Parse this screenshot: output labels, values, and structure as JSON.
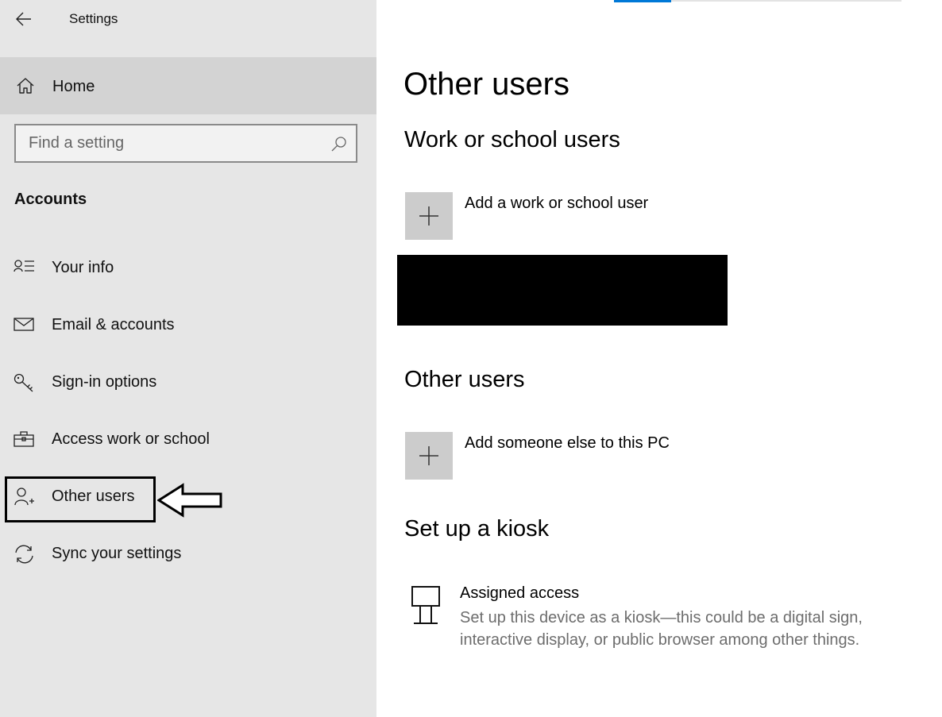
{
  "window": {
    "title": "Settings"
  },
  "sidebar": {
    "home_label": "Home",
    "search": {
      "placeholder": "Find a setting"
    },
    "section_label": "Accounts",
    "items": [
      {
        "label": "Your info",
        "icon": "person-info-icon"
      },
      {
        "label": "Email & accounts",
        "icon": "mail-icon"
      },
      {
        "label": "Sign-in options",
        "icon": "key-icon"
      },
      {
        "label": "Access work or school",
        "icon": "briefcase-icon"
      },
      {
        "label": "Other users",
        "icon": "add-person-icon",
        "selected": true
      },
      {
        "label": "Sync your settings",
        "icon": "sync-icon"
      }
    ]
  },
  "main": {
    "title": "Other users",
    "work_school": {
      "heading": "Work or school users",
      "add_label": "Add a work or school user"
    },
    "other_users": {
      "heading": "Other users",
      "add_label": "Add someone else to this PC"
    },
    "kiosk": {
      "heading": "Set up a kiosk",
      "title": "Assigned access",
      "description": "Set up this device as a kiosk—this could be a digital sign, interactive display, or public browser among other things."
    }
  },
  "colors": {
    "sidebar_bg": "#e6e6e6",
    "home_bg": "#d3d3d3",
    "accent": "#0078d7",
    "tile_bg": "#cccccc",
    "muted_text": "#6d6d6d"
  }
}
